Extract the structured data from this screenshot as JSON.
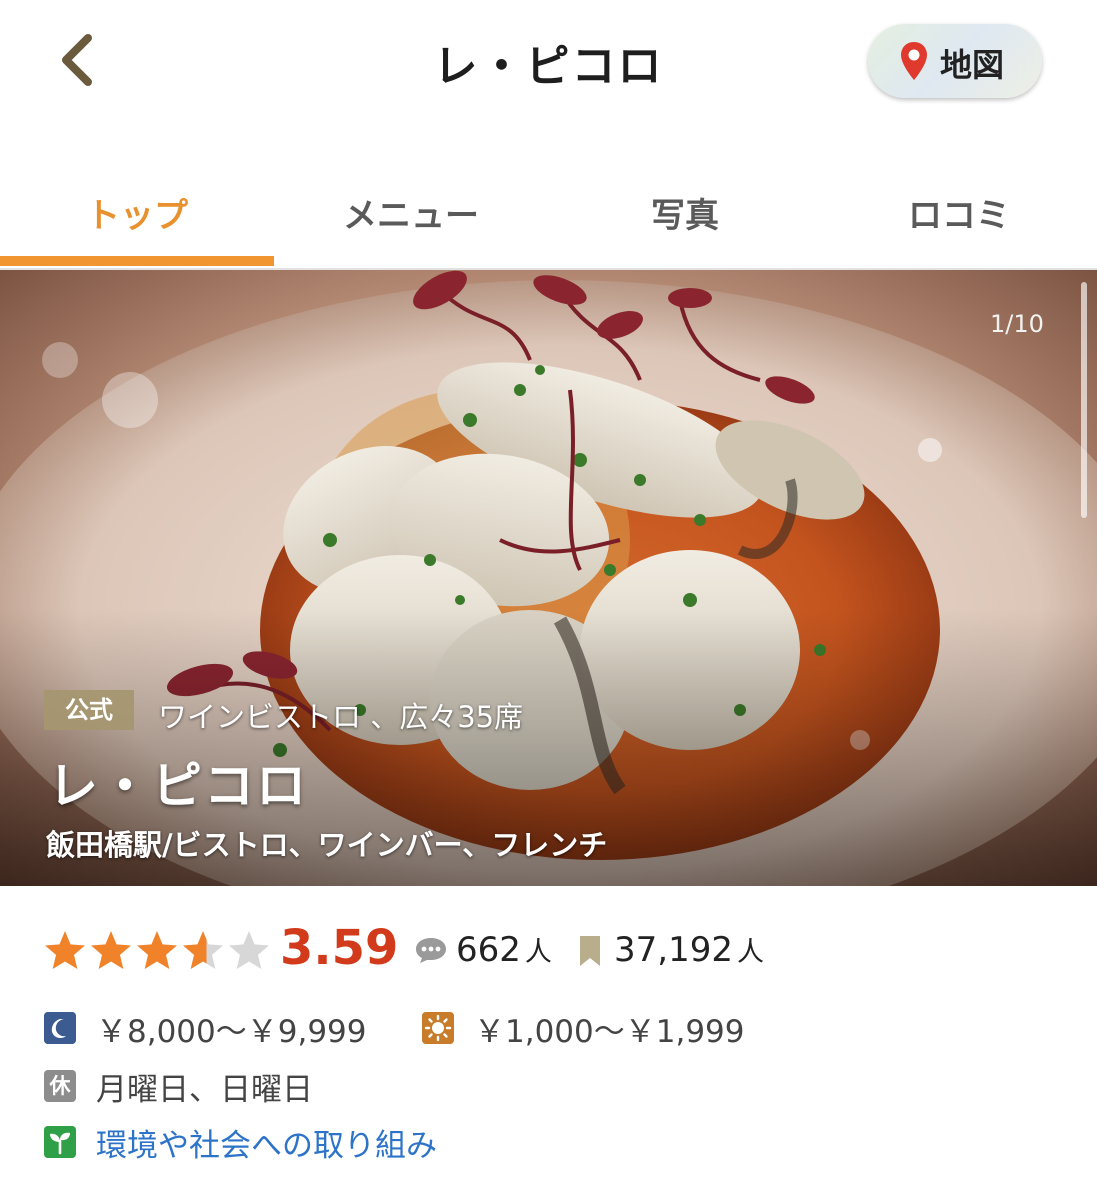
{
  "header": {
    "title": "レ・ピコロ",
    "map_label": "地図"
  },
  "tabs": [
    {
      "label": "トップ",
      "active": true
    },
    {
      "label": "メニュー",
      "active": false
    },
    {
      "label": "写真",
      "active": false
    },
    {
      "label": "ロコミ",
      "active": false
    }
  ],
  "hero": {
    "counter": "1/10",
    "badge": "公式",
    "tagline": "ワインビストロ 、広々35席",
    "name": "レ・ピコロ",
    "genre": "飯田橋駅/ビストロ、ワインバー、フレンチ"
  },
  "rating": {
    "stars": 3.59,
    "score": "3.59",
    "reviews": "662",
    "reviews_unit": "人",
    "saves": "37,192",
    "saves_unit": "人"
  },
  "info": {
    "dinner_price": "￥8,000～￥9,999",
    "lunch_price": "￥1,000～￥1,999",
    "holiday_icon": "休",
    "holidays": "月曜日、日曜日",
    "eco_link": "環境や社会への取り組み"
  },
  "colors": {
    "accent": "#f0952f",
    "score": "#d23a1c",
    "star": "#f0822a",
    "link": "#2d74c9"
  },
  "icons": [
    "back-chevron-icon",
    "map-pin-icon",
    "review-bubble-icon",
    "bookmark-icon",
    "moon-icon",
    "sun-icon",
    "sprout-icon"
  ]
}
